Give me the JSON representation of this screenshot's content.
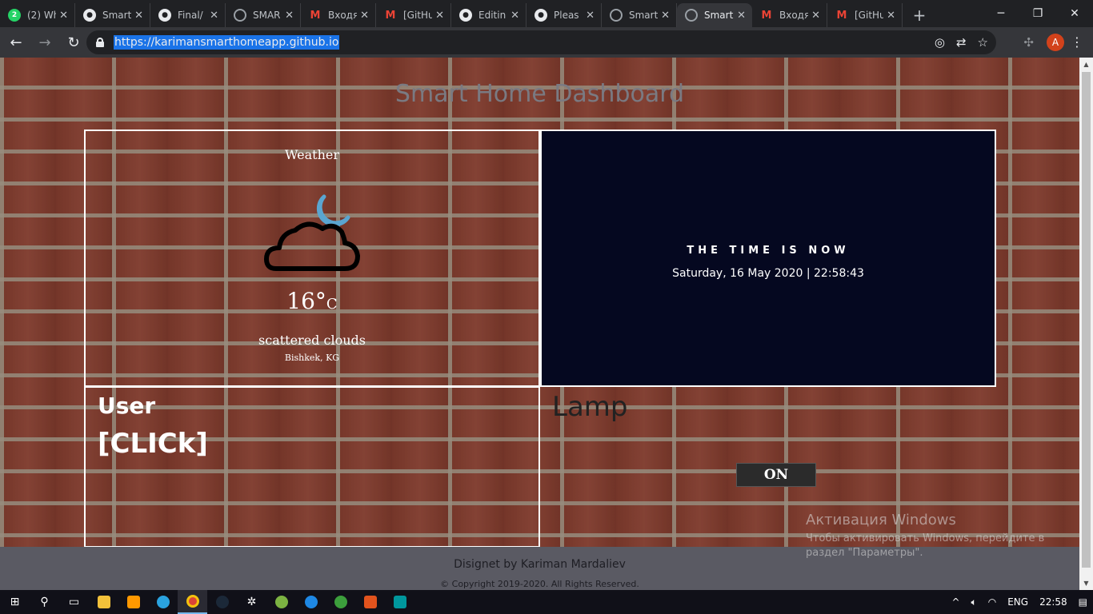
{
  "browser": {
    "tabs": [
      {
        "title": "(2) Wh",
        "icon": "whatsapp-icon",
        "badge": "2"
      },
      {
        "title": "Smart",
        "icon": "github-icon"
      },
      {
        "title": "Final/",
        "icon": "github-icon"
      },
      {
        "title": "SMAR",
        "icon": "globe-icon"
      },
      {
        "title": "Входя",
        "icon": "gmail-icon"
      },
      {
        "title": "[GitHu",
        "icon": "gmail-icon"
      },
      {
        "title": "Editin",
        "icon": "github-icon"
      },
      {
        "title": "Pleas",
        "icon": "github-icon"
      },
      {
        "title": "Smart",
        "icon": "globe-icon"
      },
      {
        "title": "Smart",
        "icon": "globe-icon",
        "active": true
      },
      {
        "title": "Входя",
        "icon": "gmail-icon"
      },
      {
        "title": "[GitHu",
        "icon": "gmail-icon"
      }
    ],
    "new_tab": "+",
    "url": "https://karimansmarthomeapp.github.io",
    "avatar_letter": "A"
  },
  "page": {
    "title": "Smart Home Dashboard",
    "weather": {
      "label": "Weather",
      "temperature": "16°",
      "unit": "C",
      "description": "scattered clouds",
      "location": "Bishkek, KG",
      "icon": "cloudy-night-icon"
    },
    "clock": {
      "label": "THE TIME IS NOW",
      "datetime": "Saturday, 16 May 2020 | 22:58:43"
    },
    "user": {
      "title": "User",
      "link": "[CLICk]"
    },
    "lamp": {
      "title": "Lamp",
      "button": "ON"
    },
    "footer": {
      "credit": "Disignet by Kariman Mardaliev",
      "copyright": "© Copyright 2019-2020. All Rights Reserved."
    }
  },
  "windows_activation": {
    "title": "Активация Windows",
    "subtitle": "Чтобы активировать Windows, перейдите в раздел \"Параметры\"."
  },
  "taskbar": {
    "language": "ENG",
    "time": "22:58"
  },
  "colors": {
    "clock_bg": "#050820",
    "footer_bg": "#5a5a63",
    "brick": "#7e3a2c",
    "moon": "#5aa5d0"
  }
}
